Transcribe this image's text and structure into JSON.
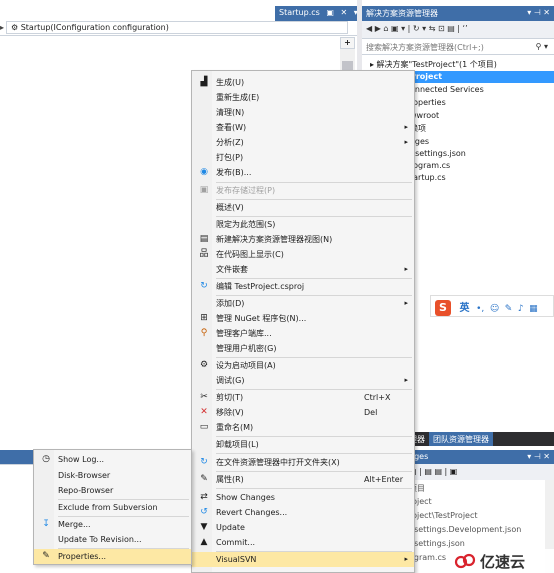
{
  "editor": {
    "tab_label": "Startup.cs",
    "tab_pin": "▣",
    "tab_close": "✕",
    "tab_dropdown": "▾",
    "nav_left_arrow": "▸",
    "nav_value": "⚙ Startup(IConfiguration configuration)",
    "plus_label": "+"
  },
  "solution_explorer": {
    "title": "解决方案资源管理器",
    "title_controls": "▾ ⊣ ✕",
    "toolbar_icons": "◀ ▶ ⌂ ▣ ▾ | ↻ ▾ ⇆ ⊡ ▤ | ‘’",
    "search_placeholder": "搜索解决方案资源管理器(Ctrl+;)",
    "search_icon": "⚲ ▾",
    "root": "▸ 解决方案\"TestProject\"(1 个项目)",
    "items": [
      {
        "label": "Project",
        "selected": true
      },
      {
        "label": "onnected Services"
      },
      {
        "label": "roperties"
      },
      {
        "label": "wwroot"
      },
      {
        "label": "赖项"
      },
      {
        "label": "ages"
      },
      {
        "label": "psettings.json"
      },
      {
        "label": "rogram.cs"
      },
      {
        "label": "tartup.cs"
      }
    ]
  },
  "ime": {
    "logo": "S",
    "lang": "英",
    "tools": [
      "•,",
      "☺",
      "✎",
      "♪",
      "▦"
    ]
  },
  "bottom": {
    "tabs": [
      {
        "label": "理器"
      },
      {
        "label": "团队资源管理器",
        "active": true
      }
    ],
    "pending_title": "nges",
    "pending_controls": "▾ ⊣ ✕",
    "pending_toolbar": "▤ | ▤ ▤ | ▣",
    "pending_rows": [
      "项目",
      "roject",
      "roject\\TestProject",
      "psettings.Development.json",
      "psettings.json",
      "ogram.cs"
    ]
  },
  "context_menu": {
    "items": [
      {
        "icon": "▟",
        "label": "生成(U)"
      },
      {
        "icon": "",
        "label": "重新生成(E)"
      },
      {
        "icon": "",
        "label": "清理(N)"
      },
      {
        "icon": "",
        "label": "查看(W)",
        "arrow": "▸"
      },
      {
        "icon": "",
        "label": "分析(Z)",
        "arrow": "▸"
      },
      {
        "icon": "",
        "label": "打包(P)"
      },
      {
        "icon": "◉",
        "label": "发布(B)..."
      },
      {
        "icon": "▣",
        "label": "发布存储过程(P)",
        "disabled": true
      },
      {
        "icon": "",
        "label": "概述(V)"
      },
      {
        "icon": "",
        "label": "限定为此范围(S)"
      },
      {
        "icon": "▤",
        "label": "新建解决方案资源管理器视图(N)"
      },
      {
        "icon": "品",
        "label": "在代码图上显示(C)"
      },
      {
        "icon": "",
        "label": "文件嵌套",
        "arrow": "▸"
      },
      {
        "icon": "↻",
        "label": "编辑 TestProject.csproj"
      },
      {
        "icon": "",
        "label": "添加(D)",
        "arrow": "▸"
      },
      {
        "icon": "⊞",
        "label": "管理 NuGet 程序包(N)..."
      },
      {
        "icon": "⚲",
        "label": "管理客户端库..."
      },
      {
        "icon": "",
        "label": "管理用户机密(G)"
      },
      {
        "icon": "⚙",
        "label": "设为启动项目(A)"
      },
      {
        "icon": "",
        "label": "调试(G)",
        "arrow": "▸"
      },
      {
        "icon": "✂",
        "label": "剪切(T)",
        "shortcut": "Ctrl+X"
      },
      {
        "icon": "✕",
        "label": "移除(V)",
        "shortcut": "Del"
      },
      {
        "icon": "▭",
        "label": "重命名(M)"
      },
      {
        "icon": "",
        "label": "卸载项目(L)"
      },
      {
        "icon": "↻",
        "label": "在文件资源管理器中打开文件夹(X)"
      },
      {
        "icon": "✎",
        "label": "属性(R)",
        "shortcut": "Alt+Enter"
      },
      {
        "icon": "⇄",
        "label": "Show Changes"
      },
      {
        "icon": "↺",
        "label": "Revert Changes..."
      },
      {
        "icon": "▼",
        "label": "Update"
      },
      {
        "icon": "▲",
        "label": "Commit..."
      },
      {
        "icon": "",
        "label": "VisualSVN",
        "arrow": "▸",
        "hover": true
      }
    ]
  },
  "submenu": {
    "items": [
      {
        "icon": "◷",
        "label": "Show Log..."
      },
      {
        "icon": "",
        "label": "Disk-Browser"
      },
      {
        "icon": "",
        "label": "Repo-Browser"
      },
      {
        "icon": "",
        "label": "Exclude from Subversion"
      },
      {
        "icon": "↧",
        "label": "Merge..."
      },
      {
        "icon": "",
        "label": "Update To Revision..."
      },
      {
        "icon": "✎",
        "label": "Properties...",
        "hover": true
      }
    ]
  },
  "watermark": {
    "text": "亿速云"
  },
  "colors": {
    "accent": "#3f6ea8",
    "selection": "#3399ff",
    "menu_hover": "#fde8a4",
    "watermark_red": "#d9232d"
  }
}
